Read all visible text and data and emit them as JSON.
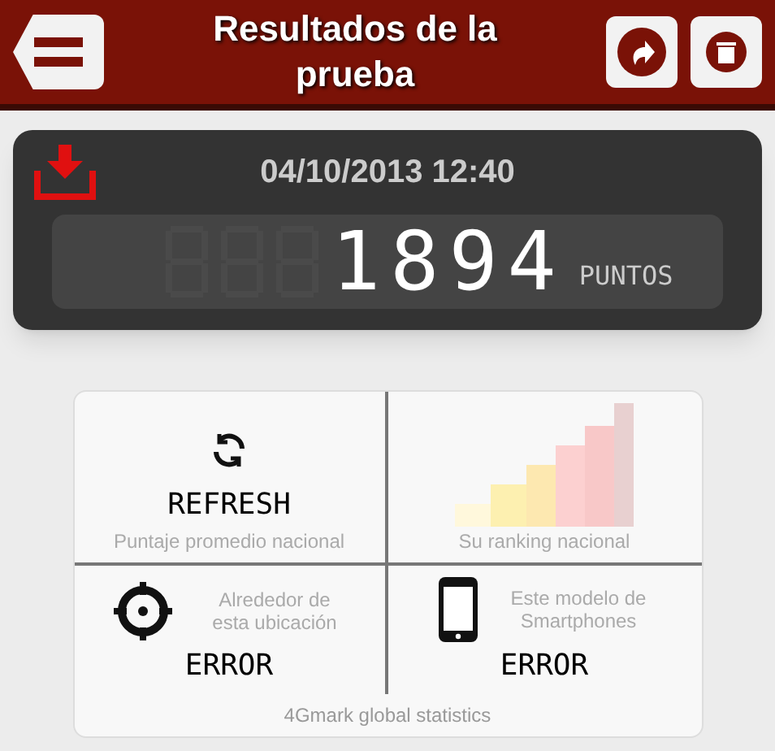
{
  "header": {
    "title": "Resultados de la prueba"
  },
  "result": {
    "datetime": "04/10/2013 12:40",
    "score": "1894",
    "unit": "PUNTOS"
  },
  "stats": {
    "cells": [
      {
        "kind": "refresh",
        "value": "REFRESH",
        "label": "Puntaje promedio nacional"
      },
      {
        "kind": "ranking",
        "label": "Su ranking nacional"
      },
      {
        "kind": "location",
        "value": "ERROR",
        "label": "Alrededor de esta ubicación"
      },
      {
        "kind": "phone",
        "value": "ERROR",
        "label": "Este modelo de Smartphones"
      }
    ],
    "footer": "4Gmark global statistics"
  }
}
